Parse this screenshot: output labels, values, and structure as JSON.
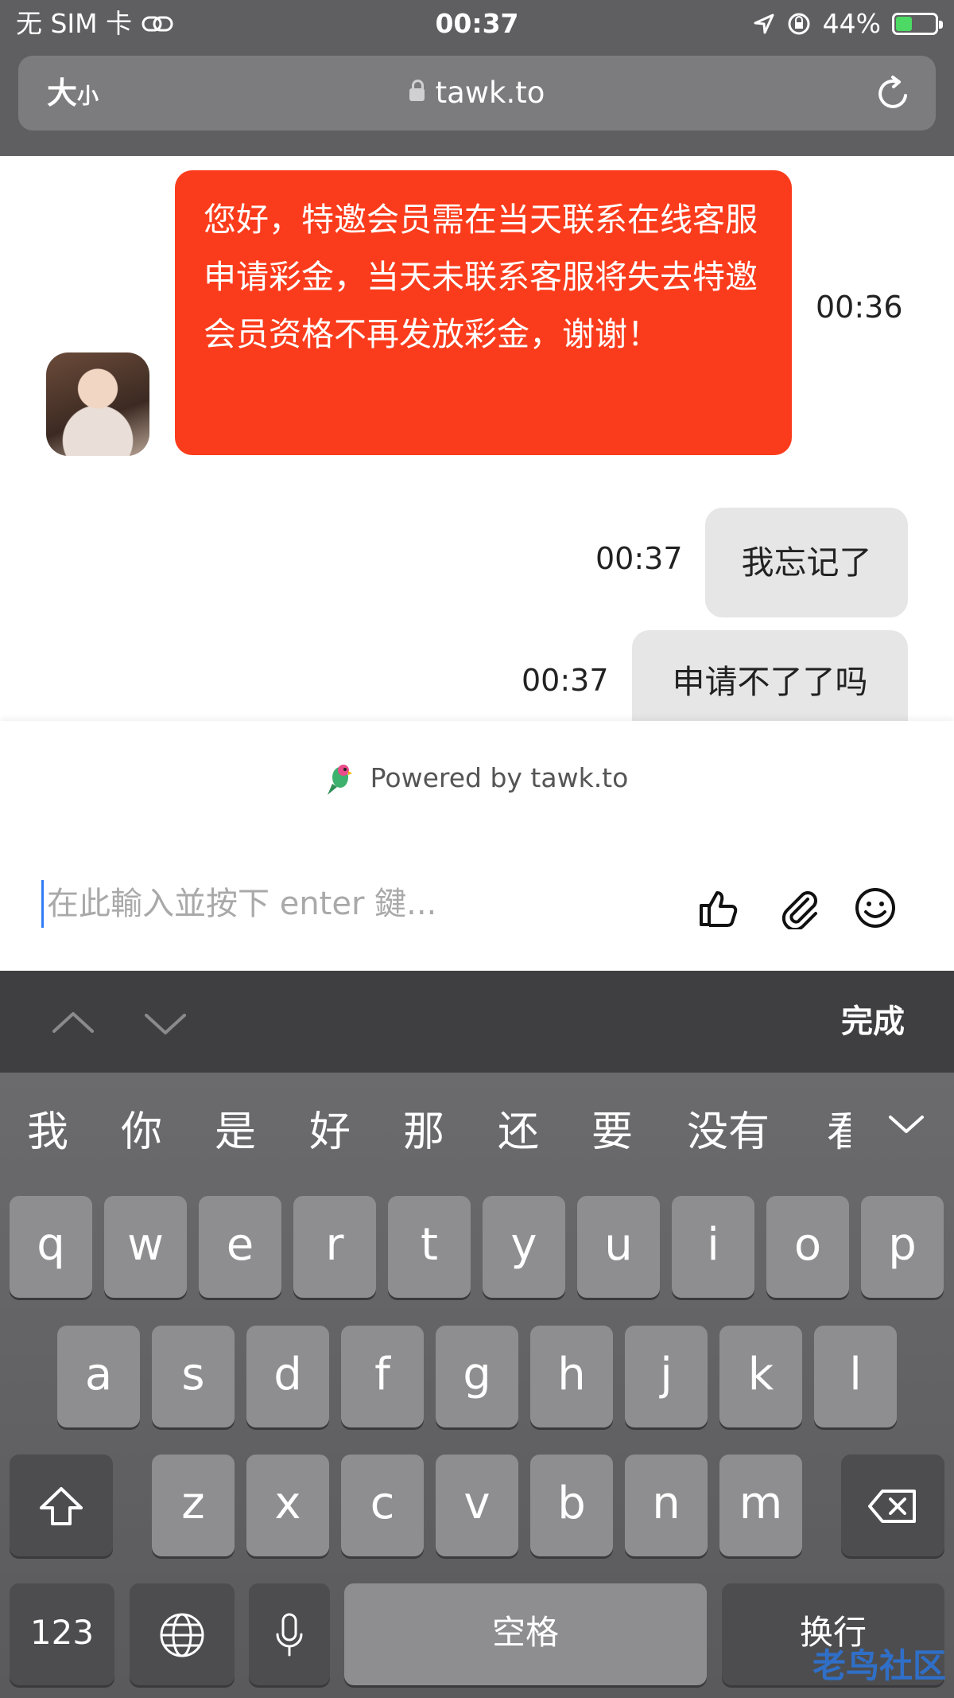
{
  "status_bar": {
    "carrier": "无 SIM 卡",
    "time": "00:37",
    "battery_percent": "44%",
    "battery_fraction": 0.44
  },
  "browser": {
    "text_size_label_big": "大",
    "text_size_label_small": "小",
    "url": "tawk.to"
  },
  "chat": {
    "messages": [
      {
        "sender": "agent",
        "text": "您好，特邀会员需在当天联系在线客服申请彩金，当天未联系客服将失去特邀会员资格不再发放彩金，谢谢！",
        "time": "00:36"
      },
      {
        "sender": "user",
        "text": "我忘记了",
        "time": "00:37"
      },
      {
        "sender": "user",
        "text": "申请不了了吗",
        "time": "00:37"
      }
    ]
  },
  "composer": {
    "powered_by": "Powered by tawk.to",
    "placeholder": "在此輸入並按下 enter 鍵..."
  },
  "keyboard_bar": {
    "done_label": "完成"
  },
  "keyboard": {
    "candidates": [
      "我",
      "你",
      "是",
      "好",
      "那",
      "还",
      "要",
      "没有",
      "看"
    ],
    "row1": [
      "q",
      "w",
      "e",
      "r",
      "t",
      "y",
      "u",
      "i",
      "o",
      "p"
    ],
    "row2": [
      "a",
      "s",
      "d",
      "f",
      "g",
      "h",
      "j",
      "k",
      "l"
    ],
    "row3": [
      "z",
      "x",
      "c",
      "v",
      "b",
      "n",
      "m"
    ],
    "numbers_label": "123",
    "space_label": "空格",
    "return_label": "换行"
  },
  "watermark": "老鸟社区",
  "colors": {
    "agent_bubble": "#fb3c1c",
    "user_bubble": "#e6e6e6",
    "chrome_bg": "#5f5f61"
  }
}
